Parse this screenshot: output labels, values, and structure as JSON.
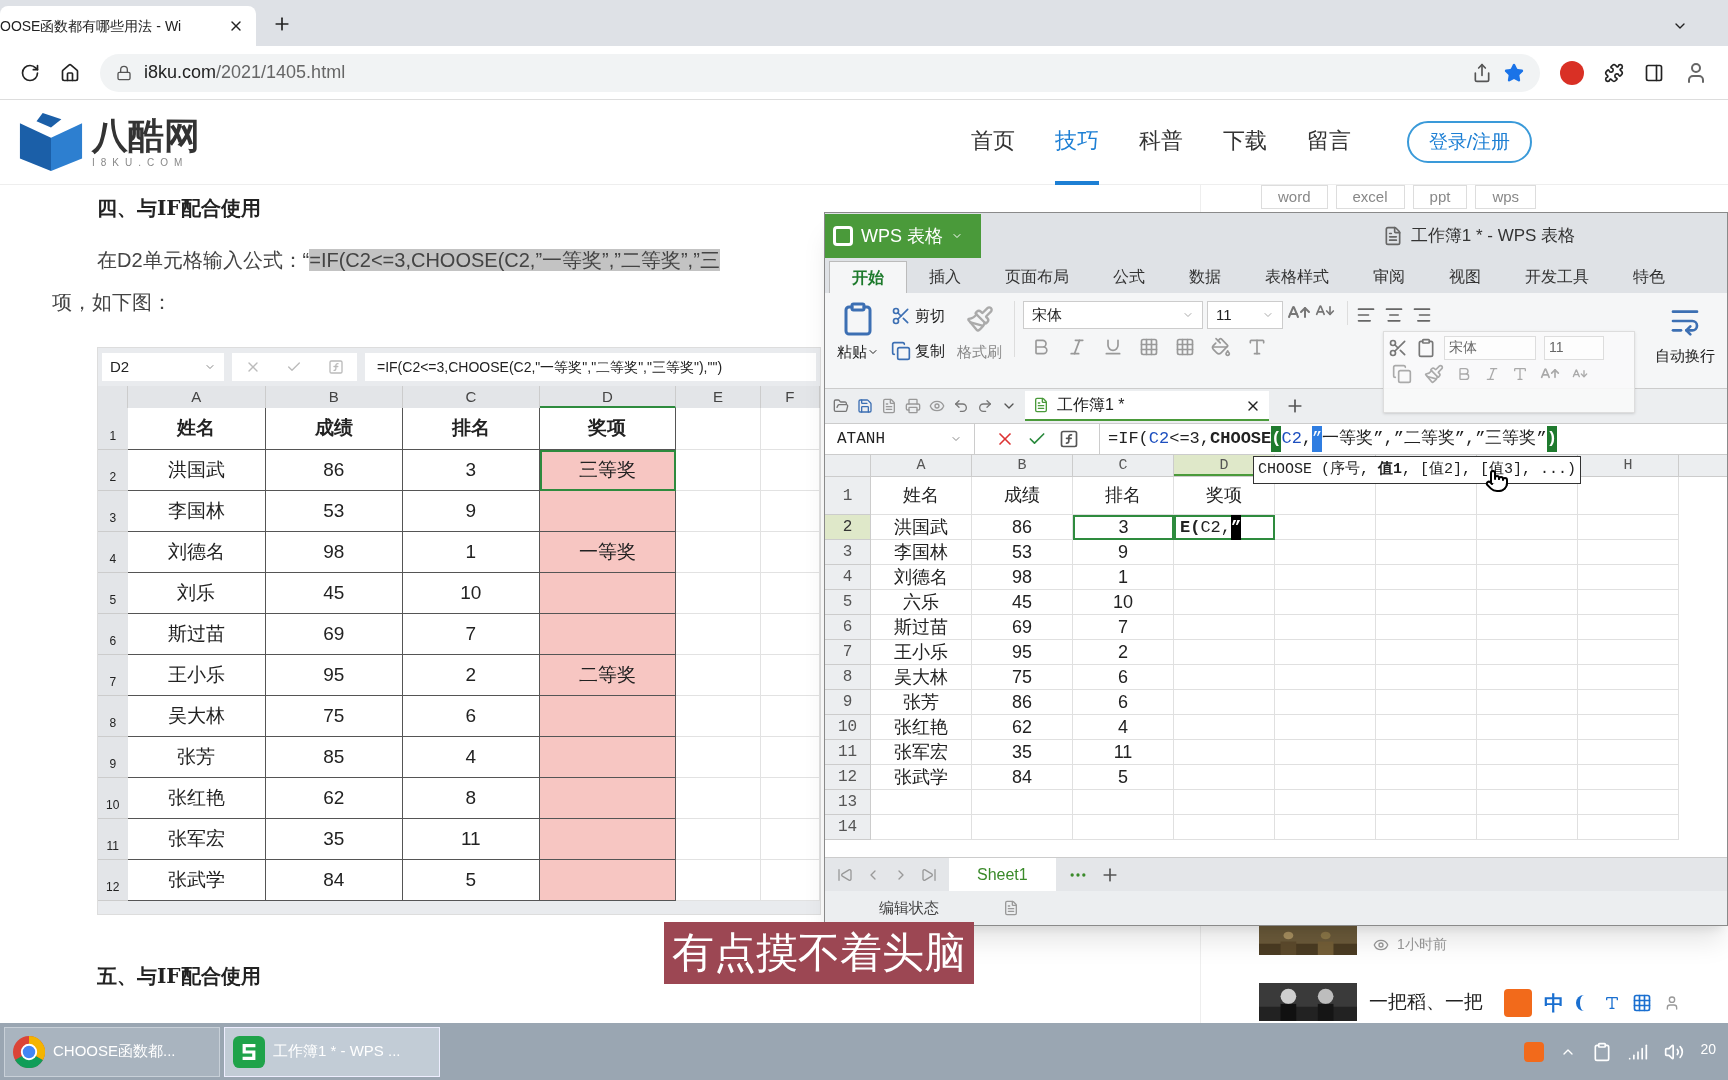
{
  "browser": {
    "tab_title": "OOSE函数都有哪些用法 - Wi",
    "address_host": "i8ku.com",
    "address_path": "/2021/1405.html"
  },
  "site": {
    "logo": "八酷网",
    "logo_sub": "I8KU.COM",
    "nav": [
      {
        "label": "首页",
        "selected": false
      },
      {
        "label": "技巧",
        "selected": true
      },
      {
        "label": "科普",
        "selected": false
      },
      {
        "label": "下载",
        "selected": false
      },
      {
        "label": "留言",
        "selected": false
      }
    ],
    "login": "登录/注册",
    "subnav": [
      "word",
      "excel",
      "ppt",
      "wps"
    ]
  },
  "article": {
    "heading": "四、与IF配合使用",
    "intro": "在D2单元格输入公式：“",
    "formula": "=IF(C2<=3,CHOOSE(C2,”一等奖”,”二等奖”,”三",
    "line2": "项，如下图：",
    "figure": {
      "name_box": "D2",
      "formula": "=IF(C2<=3,CHOOSE(C2,\"一等奖\",\"二等奖\",\"三等奖\"),\"\")",
      "columns": [
        "A",
        "B",
        "C",
        "D",
        "E",
        "F"
      ],
      "rows": [
        {
          "number": "1",
          "cells": [
            "姓名",
            "成绩",
            "排名",
            "奖项"
          ],
          "highlighted": false
        },
        {
          "number": "2",
          "cells": [
            "洪国武",
            "86",
            "3",
            "三等奖"
          ],
          "highlighted": true
        },
        {
          "number": "3",
          "cells": [
            "李国林",
            "53",
            "9"
          ],
          "highlighted": true
        },
        {
          "number": "4",
          "cells": [
            "刘德名",
            "98",
            "1",
            "一等奖"
          ],
          "highlighted": true
        },
        {
          "number": "5",
          "cells": [
            "刘乐",
            "45",
            "10"
          ],
          "highlighted": true
        },
        {
          "number": "6",
          "cells": [
            "斯过苗",
            "69",
            "7"
          ],
          "highlighted": true
        },
        {
          "number": "7",
          "cells": [
            "王小乐",
            "95",
            "2",
            "二等奖"
          ],
          "highlighted": true
        },
        {
          "number": "8",
          "cells": [
            "吴大林",
            "75",
            "6"
          ],
          "highlighted": true
        },
        {
          "number": "9",
          "cells": [
            "张芳",
            "85",
            "4"
          ],
          "highlighted": true
        },
        {
          "number": "10",
          "cells": [
            "张红艳",
            "62",
            "8"
          ],
          "highlighted": true
        },
        {
          "number": "11",
          "cells": [
            "张军宏",
            "35",
            "11"
          ],
          "highlighted": true
        },
        {
          "number": "12",
          "cells": [
            "张武学",
            "84",
            "5"
          ],
          "highlighted": true
        }
      ]
    },
    "next_heading": "五、与IF配合使用"
  },
  "sidebar": {
    "news": [
      {
        "time": "1小时前"
      },
      {
        "title": "一把稻、一把"
      }
    ]
  },
  "wps": {
    "app_button": "WPS 表格",
    "title": "工作簿1 * - WPS 表格",
    "tabs": [
      {
        "label": "开始",
        "selected": true
      },
      {
        "label": "插入",
        "selected": false
      },
      {
        "label": "页面布局",
        "selected": false
      },
      {
        "label": "公式",
        "selected": false
      },
      {
        "label": "数据",
        "selected": false
      },
      {
        "label": "表格样式",
        "selected": false
      },
      {
        "label": "审阅",
        "selected": false
      },
      {
        "label": "视图",
        "selected": false
      },
      {
        "label": "开发工具",
        "selected": false
      },
      {
        "label": "特色",
        "selected": false
      }
    ],
    "ribbon": {
      "paste": "粘贴",
      "cut": "剪切",
      "copy": "复制",
      "format_painter": "格式刷",
      "font": "宋体",
      "size": "11",
      "wrap": "自动换行"
    },
    "mini_toolbar": {
      "font": "宋体",
      "size": "11"
    },
    "doc_tab": "工作簿1 *",
    "name_box": "ATANH",
    "formula": [
      {
        "text": "=IF(",
        "kind": "plain"
      },
      {
        "text": "C2",
        "kind": "ref"
      },
      {
        "text": "<=3,",
        "kind": "plain"
      },
      {
        "text": "CHOOSE",
        "kind": "bold"
      },
      {
        "text": "(",
        "kind": "paren"
      },
      {
        "text": "C2",
        "kind": "ref"
      },
      {
        "text": ",",
        "kind": "plain"
      },
      {
        "text": "”",
        "kind": "selected"
      },
      {
        "text": "一等奖”,”二等奖”,”三等奖”",
        "kind": "plain"
      },
      {
        "text": ")",
        "kind": "paren"
      }
    ],
    "tooltip": "CHOOSE (序号, **值1**, [值2], [值3], ...)",
    "columns": [
      "A",
      "B",
      "C",
      "D"
    ],
    "last_column": "H",
    "rows": [
      {
        "number": "1",
        "cells": [
          "姓名",
          "成绩",
          "排名",
          "奖项"
        ],
        "selected": false
      },
      {
        "number": "2",
        "cells": [
          "洪国武",
          "86",
          "3"
        ],
        "selected": true
      },
      {
        "number": "3",
        "cells": [
          "李国林",
          "53",
          "9"
        ],
        "selected": false
      },
      {
        "number": "4",
        "cells": [
          "刘德名",
          "98",
          "1"
        ],
        "selected": false
      },
      {
        "number": "5",
        "cells": [
          "六乐",
          "45",
          "10"
        ],
        "selected": false
      },
      {
        "number": "6",
        "cells": [
          "斯过苗",
          "69",
          "7"
        ],
        "selected": false
      },
      {
        "number": "7",
        "cells": [
          "王小乐",
          "95",
          "2"
        ],
        "selected": false
      },
      {
        "number": "8",
        "cells": [
          "吴大林",
          "75",
          "6"
        ],
        "selected": false
      },
      {
        "number": "9",
        "cells": [
          "张芳",
          "86",
          "6"
        ],
        "selected": false
      },
      {
        "number": "10",
        "cells": [
          "张红艳",
          "62",
          "4"
        ],
        "selected": false
      },
      {
        "number": "11",
        "cells": [
          "张军宏",
          "35",
          "11"
        ],
        "selected": false
      },
      {
        "number": "12",
        "cells": [
          "张武学",
          "84",
          "5"
        ],
        "selected": false
      },
      {
        "number": "13",
        "cells": [],
        "selected": false
      },
      {
        "number": "14",
        "cells": [],
        "selected": false
      }
    ],
    "edit": [
      {
        "text": "E(",
        "kind": "bold"
      },
      {
        "text": "C2,",
        "kind": "plain"
      },
      {
        "text": "”",
        "kind": "selected"
      }
    ],
    "sheet_tabs": [
      {
        "label": "Sheet1",
        "selected": true
      }
    ],
    "status": "编辑状态"
  },
  "subtitle": "有点摸不着头脑",
  "ime": {
    "label": "中"
  },
  "taskbar": {
    "items": [
      {
        "label": "CHOOSE函数都...",
        "kind": "chrome",
        "selected": false
      },
      {
        "label": "工作簿1 * - WPS ...",
        "kind": "wps",
        "selected": true
      }
    ],
    "clock": "20"
  }
}
